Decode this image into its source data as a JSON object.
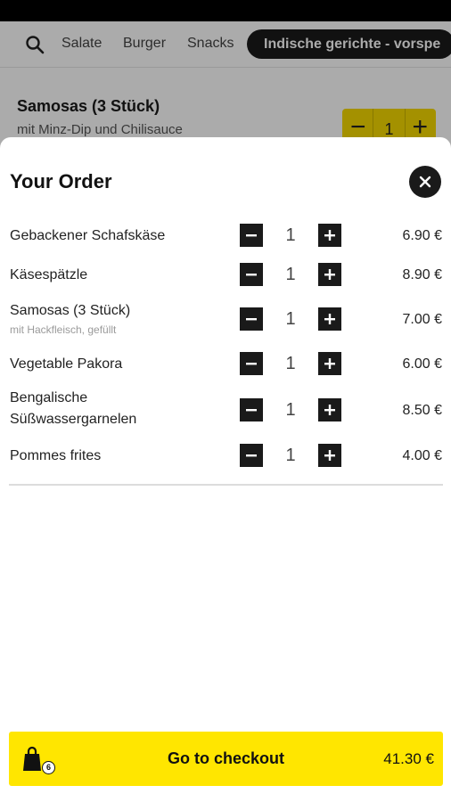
{
  "category_nav": {
    "items": [
      "Salate",
      "Burger",
      "Snacks"
    ],
    "active": "Indische gerichte - vorspe"
  },
  "background_dish": {
    "name": "Samosas (3 Stück)",
    "description": "mit Minz-Dip und Chilisauce",
    "quantity": "1",
    "minus_symbol": "−",
    "plus_symbol": "+"
  },
  "order": {
    "title": "Your Order",
    "items": [
      {
        "name": "Gebackener Schafskäse",
        "note": "",
        "quantity": "1",
        "price": "6.90 €"
      },
      {
        "name": "Käsespätzle",
        "note": "",
        "quantity": "1",
        "price": "8.90 €"
      },
      {
        "name": "Samosas (3 Stück)",
        "note": "mit Hackfleisch, gefüllt",
        "quantity": "1",
        "price": "7.00 €"
      },
      {
        "name": "Vegetable Pakora",
        "note": "",
        "quantity": "1",
        "price": "6.00 €"
      },
      {
        "name": "Bengalische Süßwassergarnelen",
        "note": "",
        "quantity": "1",
        "price": "8.50 €"
      },
      {
        "name": "Pommes frites",
        "note": "",
        "quantity": "1",
        "price": "4.00 €"
      }
    ]
  },
  "checkout": {
    "label": "Go to checkout",
    "total": "41.30 €",
    "item_count": "6"
  },
  "colors": {
    "accent_yellow": "#ffe600",
    "dark": "#1a1a1a"
  },
  "icons": {
    "search": "search-icon",
    "close": "close-icon",
    "minus": "minus-icon",
    "plus": "plus-icon",
    "bag": "shopping-bag-icon"
  }
}
